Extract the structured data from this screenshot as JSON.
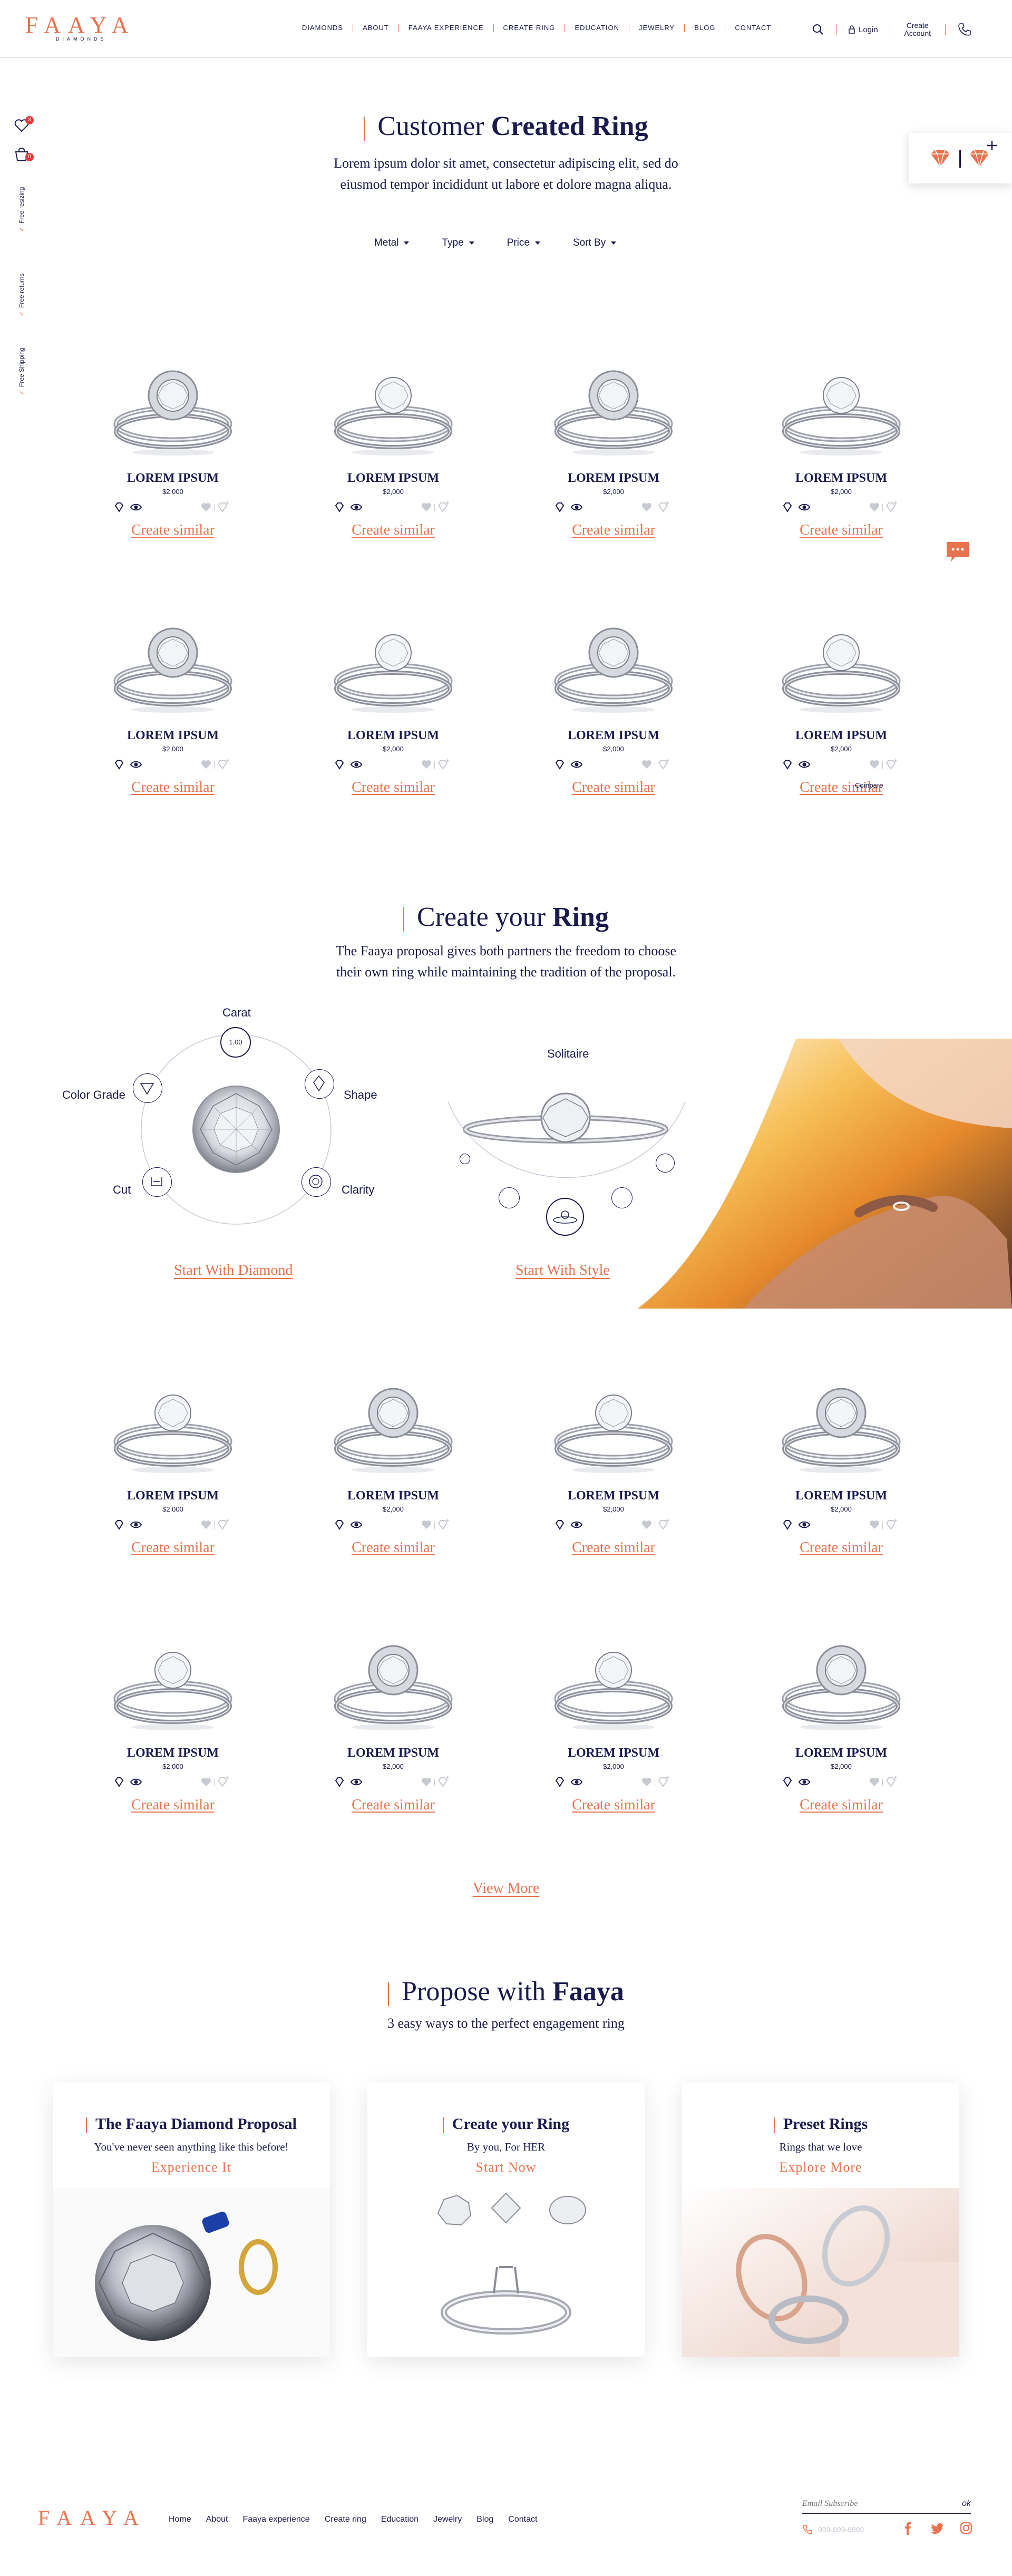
{
  "header": {
    "logo": "FAAYA",
    "logo_sub": "DIAMONDS",
    "nav": [
      "DIAMONDS",
      "ABOUT",
      "FAAYA EXPERIENCE",
      "CREATE RING",
      "EDUCATION",
      "JEWELRY",
      "BLOG",
      "CONTACT"
    ],
    "login": "Login",
    "create_account": "Create Account"
  },
  "sidebar": {
    "wishlist_count": "3",
    "cart_count": "0",
    "perks": [
      "Free resizing",
      "Free returns",
      "Free Shipping"
    ]
  },
  "customer_section": {
    "title_light": "Customer",
    "title_bold": "Created Ring",
    "subtitle_1": "Lorem ipsum dolor sit amet, consectetur adipiscing elit, sed do",
    "subtitle_2": "eiusmod tempor incididunt ut labore et dolore magna aliqua.",
    "filters": [
      "Metal",
      "Type",
      "Price",
      "Sort By"
    ],
    "compare_label": "Compare"
  },
  "products_top": [
    {
      "name": "LOREM IPSUM",
      "price": "$2,000",
      "cta": "Create similar"
    },
    {
      "name": "LOREM IPSUM",
      "price": "$2,000",
      "cta": "Create similar"
    },
    {
      "name": "LOREM IPSUM",
      "price": "$2,000",
      "cta": "Create similar"
    },
    {
      "name": "LOREM IPSUM",
      "price": "$2,000",
      "cta": "Create similar"
    },
    {
      "name": "LOREM IPSUM",
      "price": "$2,000",
      "cta": "Create similar"
    },
    {
      "name": "LOREM IPSUM",
      "price": "$2,000",
      "cta": "Create similar"
    },
    {
      "name": "LOREM IPSUM",
      "price": "$2,000",
      "cta": "Create similar"
    },
    {
      "name": "LOREM IPSUM",
      "price": "$2,000",
      "cta": "Create similar"
    }
  ],
  "create_section": {
    "title_light": "Create your",
    "title_bold": "Ring",
    "subtitle_1": "The Faaya proposal gives both partners the freedom to choose",
    "subtitle_2": "their own ring while maintaining the tradition of the proposal.",
    "diamond_options": [
      "Carat",
      "Shape",
      "Clarity",
      "Cut",
      "Color Grade"
    ],
    "carat_value": "1.00",
    "start_diamond": "Start With Diamond",
    "style_label": "Solitaire",
    "start_style": "Start With Style"
  },
  "products_bottom": [
    {
      "name": "LOREM IPSUM",
      "price": "$2,000",
      "cta": "Create similar"
    },
    {
      "name": "LOREM IPSUM",
      "price": "$2,000",
      "cta": "Create similar"
    },
    {
      "name": "LOREM IPSUM",
      "price": "$2,000",
      "cta": "Create similar"
    },
    {
      "name": "LOREM IPSUM",
      "price": "$2,000",
      "cta": "Create similar"
    },
    {
      "name": "LOREM IPSUM",
      "price": "$2,000",
      "cta": "Create similar"
    },
    {
      "name": "LOREM IPSUM",
      "price": "$2,000",
      "cta": "Create similar"
    },
    {
      "name": "LOREM IPSUM",
      "price": "$2,000",
      "cta": "Create similar"
    },
    {
      "name": "LOREM IPSUM",
      "price": "$2,000",
      "cta": "Create similar"
    }
  ],
  "view_more": "View More",
  "propose_section": {
    "title_light": "Propose with",
    "title_bold": "Faaya",
    "subtitle": "3 easy ways to the perfect engagement ring",
    "cards": [
      {
        "title": "The Faaya Diamond Proposal",
        "sub": "You've never seen anything like this before!",
        "link": "Experience It"
      },
      {
        "title": "Create your Ring",
        "sub": "By you, For HER",
        "link": "Start Now"
      },
      {
        "title": "Preset Rings",
        "sub": "Rings that we love",
        "link": "Explore More"
      }
    ]
  },
  "footer": {
    "logo": "FAAYA",
    "links": [
      "Home",
      "About",
      "Faaya experience",
      "Create ring",
      "Education",
      "Jewelry",
      "Blog",
      "Contact"
    ],
    "subscribe_placeholder": "Email Subscribe",
    "subscribe_ok": "ok",
    "phone": "999-999-9999"
  },
  "colors": {
    "navy": "#1a1a4e",
    "accent": "#e8734f"
  }
}
